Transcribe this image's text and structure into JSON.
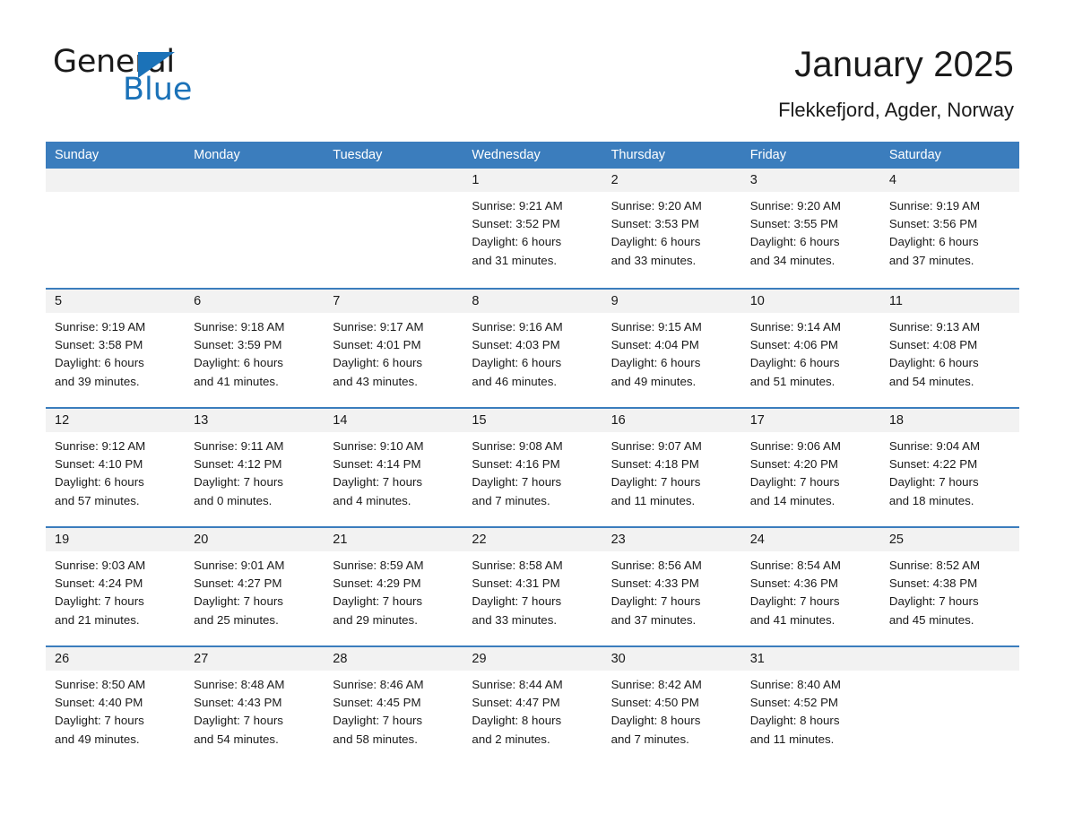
{
  "brand": {
    "word_general": "General",
    "word_blue": "Blue",
    "triangle_color": "#1b72b8",
    "icon": "general-blue-logo"
  },
  "header": {
    "title": "January 2025",
    "location": "Flekkefjord, Agder, Norway"
  },
  "theme": {
    "header_blue": "#3b7dbd",
    "daynum_band": "#f2f2f2",
    "text": "#1a1a1a"
  },
  "weekday_headers": [
    "Sunday",
    "Monday",
    "Tuesday",
    "Wednesday",
    "Thursday",
    "Friday",
    "Saturday"
  ],
  "weeks": [
    [
      {
        "day": "",
        "empty": true,
        "sunrise": "",
        "sunset": "",
        "daylight_1": "",
        "daylight_2": ""
      },
      {
        "day": "",
        "empty": true,
        "sunrise": "",
        "sunset": "",
        "daylight_1": "",
        "daylight_2": ""
      },
      {
        "day": "",
        "empty": true,
        "sunrise": "",
        "sunset": "",
        "daylight_1": "",
        "daylight_2": ""
      },
      {
        "day": "1",
        "empty": false,
        "sunrise": "Sunrise: 9:21 AM",
        "sunset": "Sunset: 3:52 PM",
        "daylight_1": "Daylight: 6 hours",
        "daylight_2": "and 31 minutes."
      },
      {
        "day": "2",
        "empty": false,
        "sunrise": "Sunrise: 9:20 AM",
        "sunset": "Sunset: 3:53 PM",
        "daylight_1": "Daylight: 6 hours",
        "daylight_2": "and 33 minutes."
      },
      {
        "day": "3",
        "empty": false,
        "sunrise": "Sunrise: 9:20 AM",
        "sunset": "Sunset: 3:55 PM",
        "daylight_1": "Daylight: 6 hours",
        "daylight_2": "and 34 minutes."
      },
      {
        "day": "4",
        "empty": false,
        "sunrise": "Sunrise: 9:19 AM",
        "sunset": "Sunset: 3:56 PM",
        "daylight_1": "Daylight: 6 hours",
        "daylight_2": "and 37 minutes."
      }
    ],
    [
      {
        "day": "5",
        "empty": false,
        "sunrise": "Sunrise: 9:19 AM",
        "sunset": "Sunset: 3:58 PM",
        "daylight_1": "Daylight: 6 hours",
        "daylight_2": "and 39 minutes."
      },
      {
        "day": "6",
        "empty": false,
        "sunrise": "Sunrise: 9:18 AM",
        "sunset": "Sunset: 3:59 PM",
        "daylight_1": "Daylight: 6 hours",
        "daylight_2": "and 41 minutes."
      },
      {
        "day": "7",
        "empty": false,
        "sunrise": "Sunrise: 9:17 AM",
        "sunset": "Sunset: 4:01 PM",
        "daylight_1": "Daylight: 6 hours",
        "daylight_2": "and 43 minutes."
      },
      {
        "day": "8",
        "empty": false,
        "sunrise": "Sunrise: 9:16 AM",
        "sunset": "Sunset: 4:03 PM",
        "daylight_1": "Daylight: 6 hours",
        "daylight_2": "and 46 minutes."
      },
      {
        "day": "9",
        "empty": false,
        "sunrise": "Sunrise: 9:15 AM",
        "sunset": "Sunset: 4:04 PM",
        "daylight_1": "Daylight: 6 hours",
        "daylight_2": "and 49 minutes."
      },
      {
        "day": "10",
        "empty": false,
        "sunrise": "Sunrise: 9:14 AM",
        "sunset": "Sunset: 4:06 PM",
        "daylight_1": "Daylight: 6 hours",
        "daylight_2": "and 51 minutes."
      },
      {
        "day": "11",
        "empty": false,
        "sunrise": "Sunrise: 9:13 AM",
        "sunset": "Sunset: 4:08 PM",
        "daylight_1": "Daylight: 6 hours",
        "daylight_2": "and 54 minutes."
      }
    ],
    [
      {
        "day": "12",
        "empty": false,
        "sunrise": "Sunrise: 9:12 AM",
        "sunset": "Sunset: 4:10 PM",
        "daylight_1": "Daylight: 6 hours",
        "daylight_2": "and 57 minutes."
      },
      {
        "day": "13",
        "empty": false,
        "sunrise": "Sunrise: 9:11 AM",
        "sunset": "Sunset: 4:12 PM",
        "daylight_1": "Daylight: 7 hours",
        "daylight_2": "and 0 minutes."
      },
      {
        "day": "14",
        "empty": false,
        "sunrise": "Sunrise: 9:10 AM",
        "sunset": "Sunset: 4:14 PM",
        "daylight_1": "Daylight: 7 hours",
        "daylight_2": "and 4 minutes."
      },
      {
        "day": "15",
        "empty": false,
        "sunrise": "Sunrise: 9:08 AM",
        "sunset": "Sunset: 4:16 PM",
        "daylight_1": "Daylight: 7 hours",
        "daylight_2": "and 7 minutes."
      },
      {
        "day": "16",
        "empty": false,
        "sunrise": "Sunrise: 9:07 AM",
        "sunset": "Sunset: 4:18 PM",
        "daylight_1": "Daylight: 7 hours",
        "daylight_2": "and 11 minutes."
      },
      {
        "day": "17",
        "empty": false,
        "sunrise": "Sunrise: 9:06 AM",
        "sunset": "Sunset: 4:20 PM",
        "daylight_1": "Daylight: 7 hours",
        "daylight_2": "and 14 minutes."
      },
      {
        "day": "18",
        "empty": false,
        "sunrise": "Sunrise: 9:04 AM",
        "sunset": "Sunset: 4:22 PM",
        "daylight_1": "Daylight: 7 hours",
        "daylight_2": "and 18 minutes."
      }
    ],
    [
      {
        "day": "19",
        "empty": false,
        "sunrise": "Sunrise: 9:03 AM",
        "sunset": "Sunset: 4:24 PM",
        "daylight_1": "Daylight: 7 hours",
        "daylight_2": "and 21 minutes."
      },
      {
        "day": "20",
        "empty": false,
        "sunrise": "Sunrise: 9:01 AM",
        "sunset": "Sunset: 4:27 PM",
        "daylight_1": "Daylight: 7 hours",
        "daylight_2": "and 25 minutes."
      },
      {
        "day": "21",
        "empty": false,
        "sunrise": "Sunrise: 8:59 AM",
        "sunset": "Sunset: 4:29 PM",
        "daylight_1": "Daylight: 7 hours",
        "daylight_2": "and 29 minutes."
      },
      {
        "day": "22",
        "empty": false,
        "sunrise": "Sunrise: 8:58 AM",
        "sunset": "Sunset: 4:31 PM",
        "daylight_1": "Daylight: 7 hours",
        "daylight_2": "and 33 minutes."
      },
      {
        "day": "23",
        "empty": false,
        "sunrise": "Sunrise: 8:56 AM",
        "sunset": "Sunset: 4:33 PM",
        "daylight_1": "Daylight: 7 hours",
        "daylight_2": "and 37 minutes."
      },
      {
        "day": "24",
        "empty": false,
        "sunrise": "Sunrise: 8:54 AM",
        "sunset": "Sunset: 4:36 PM",
        "daylight_1": "Daylight: 7 hours",
        "daylight_2": "and 41 minutes."
      },
      {
        "day": "25",
        "empty": false,
        "sunrise": "Sunrise: 8:52 AM",
        "sunset": "Sunset: 4:38 PM",
        "daylight_1": "Daylight: 7 hours",
        "daylight_2": "and 45 minutes."
      }
    ],
    [
      {
        "day": "26",
        "empty": false,
        "sunrise": "Sunrise: 8:50 AM",
        "sunset": "Sunset: 4:40 PM",
        "daylight_1": "Daylight: 7 hours",
        "daylight_2": "and 49 minutes."
      },
      {
        "day": "27",
        "empty": false,
        "sunrise": "Sunrise: 8:48 AM",
        "sunset": "Sunset: 4:43 PM",
        "daylight_1": "Daylight: 7 hours",
        "daylight_2": "and 54 minutes."
      },
      {
        "day": "28",
        "empty": false,
        "sunrise": "Sunrise: 8:46 AM",
        "sunset": "Sunset: 4:45 PM",
        "daylight_1": "Daylight: 7 hours",
        "daylight_2": "and 58 minutes."
      },
      {
        "day": "29",
        "empty": false,
        "sunrise": "Sunrise: 8:44 AM",
        "sunset": "Sunset: 4:47 PM",
        "daylight_1": "Daylight: 8 hours",
        "daylight_2": "and 2 minutes."
      },
      {
        "day": "30",
        "empty": false,
        "sunrise": "Sunrise: 8:42 AM",
        "sunset": "Sunset: 4:50 PM",
        "daylight_1": "Daylight: 8 hours",
        "daylight_2": "and 7 minutes."
      },
      {
        "day": "31",
        "empty": false,
        "sunrise": "Sunrise: 8:40 AM",
        "sunset": "Sunset: 4:52 PM",
        "daylight_1": "Daylight: 8 hours",
        "daylight_2": "and 11 minutes."
      },
      {
        "day": "",
        "empty": true,
        "sunrise": "",
        "sunset": "",
        "daylight_1": "",
        "daylight_2": ""
      }
    ]
  ]
}
